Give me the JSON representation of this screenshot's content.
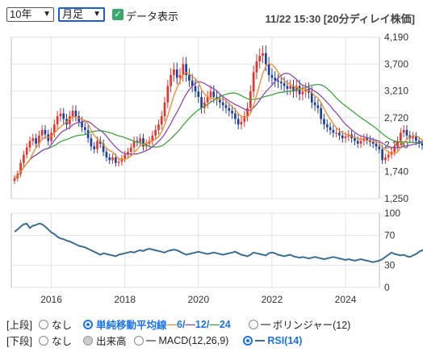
{
  "controls": {
    "period_select": "10年",
    "frequency_select": "月足",
    "data_display_label": "データ表示",
    "timestamp": "11/22 15:30 [20分ディレイ株価]"
  },
  "colors": {
    "up": "#e8322b",
    "down": "#1f3f9f",
    "ma6": "#f08a24",
    "ma12": "#8d4ab0",
    "ma24": "#3ea63e",
    "rsi": "#3b6e92",
    "accent": "#1a73e8"
  },
  "chart_data": [
    {
      "type": "candlestick",
      "title": "",
      "ylim": [
        1250,
        4190
      ],
      "y_ticks": [
        "4,190",
        "3,700",
        "3,210",
        "2,720",
        "2,230",
        "1,740",
        "1,250"
      ],
      "x_ticks": [
        "2016",
        "2018",
        "2020",
        "2022",
        "2024"
      ],
      "x_tick_dates": [
        "2016-01",
        "2018-01",
        "2020-01",
        "2022-01",
        "2024-01"
      ],
      "date_range": [
        "2015-01",
        "2024-11"
      ],
      "closes_monthly": [
        1620,
        1700,
        1900,
        2050,
        2180,
        2300,
        2350,
        2250,
        2400,
        2500,
        2420,
        2300,
        2450,
        2600,
        2750,
        2800,
        2700,
        2600,
        2750,
        2850,
        2750,
        2650,
        2550,
        2500,
        2350,
        2200,
        2150,
        2300,
        2250,
        2100,
        2000,
        1950,
        2000,
        1900,
        1920,
        1980,
        2050,
        2100,
        2180,
        2300,
        2280,
        2350,
        2200,
        2250,
        2300,
        2400,
        2500,
        2600,
        2750,
        3000,
        3300,
        3500,
        3600,
        3450,
        3500,
        3700,
        3500,
        3400,
        3300,
        3200,
        3100,
        2900,
        3000,
        3100,
        3200,
        3100,
        3050,
        3000,
        2950,
        2900,
        2850,
        2800,
        2700,
        2600,
        2650,
        2750,
        2900,
        3200,
        3550,
        3750,
        3850,
        3900,
        3700,
        3500,
        3450,
        3400,
        3380,
        3350,
        3300,
        3250,
        3300,
        3200,
        3300,
        3150,
        3200,
        3250,
        3180,
        3000,
        2950,
        2900,
        2700,
        2600,
        2550,
        2500,
        2450,
        2450,
        2400,
        2350,
        2380,
        2420,
        2350,
        2300,
        2250,
        2300,
        2350,
        2320,
        2280,
        2250,
        2200,
        2150,
        1950,
        2000,
        2050,
        2100,
        2200,
        2300,
        2450,
        2500,
        2400,
        2350,
        2380,
        2300,
        2250,
        2220,
        2180,
        2150
      ],
      "ma_labels": [
        "単純移動平均線",
        "6",
        "12",
        "24"
      ]
    },
    {
      "type": "line",
      "title": "",
      "ylim": [
        0,
        100
      ],
      "y_ticks": [
        "100",
        "70",
        "30",
        "0"
      ],
      "values_monthly": [
        75,
        78,
        82,
        85,
        86,
        80,
        83,
        84,
        86,
        85,
        82,
        78,
        74,
        72,
        68,
        66,
        65,
        63,
        62,
        60,
        58,
        56,
        55,
        54,
        52,
        50,
        48,
        46,
        44,
        46,
        45,
        44,
        43,
        42,
        44,
        45,
        46,
        47,
        48,
        47,
        49,
        50,
        49,
        51,
        52,
        51,
        50,
        49,
        48,
        47,
        49,
        50,
        51,
        50,
        48,
        46,
        44,
        45,
        46,
        47,
        48,
        47,
        46,
        45,
        46,
        47,
        46,
        45,
        44,
        45,
        46,
        47,
        48,
        46,
        44,
        43,
        42,
        44,
        47,
        46,
        45,
        44,
        43,
        46,
        47,
        46,
        44,
        43,
        42,
        43,
        44,
        42,
        41,
        40,
        41,
        40,
        39,
        40,
        41,
        40,
        39,
        38,
        39,
        40,
        41,
        40,
        39,
        38,
        37,
        38,
        37,
        36,
        37,
        38,
        37,
        36,
        35,
        34,
        35,
        36,
        38,
        41,
        44,
        47,
        45,
        44,
        43,
        44,
        42,
        41,
        43,
        45,
        48,
        50,
        51,
        49,
        48
      ]
    }
  ],
  "options_upper": {
    "prefix": "[上段]",
    "none": "なし",
    "sma_label": "単純移動平均線",
    "sma_6": "6",
    "sma_12": "12",
    "sma_24": "24",
    "bollinger": "ボリンジャー(12)"
  },
  "options_lower": {
    "prefix": "[下段]",
    "none": "なし",
    "volume": "出来高",
    "macd": "MACD(12,26,9)",
    "rsi": "RSI(14)"
  }
}
